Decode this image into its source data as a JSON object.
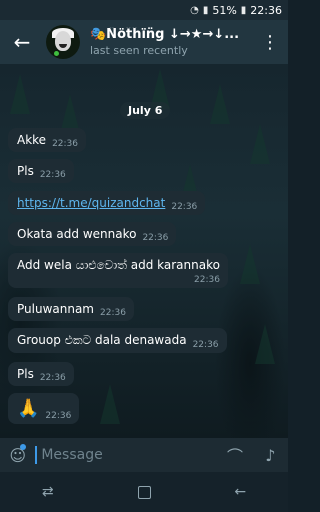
{
  "status_bar": {
    "battery": "51%",
    "time": "22:36"
  },
  "header": {
    "title": "🎭N̈öẗḧïn̈g ↓→★→↓...",
    "status": "last seen recently"
  },
  "chat": {
    "date": "July 6",
    "messages": [
      {
        "text": "Akke",
        "time": "22:36"
      },
      {
        "text": "Pls",
        "time": "22:36"
      },
      {
        "text": "https://t.me/quizandchat",
        "time": "22:36"
      },
      {
        "text": "Okata add wennako",
        "time": "22:36"
      },
      {
        "text": "Add wela යාළුවොත් add karannako",
        "time": "22:36"
      },
      {
        "text": "Puluwannam",
        "time": "22:36"
      },
      {
        "text": "Grouop එකට dala denawada",
        "time": "22:36"
      },
      {
        "text": "Pls",
        "time": "22:36"
      },
      {
        "text": "🙏",
        "time": "22:36"
      }
    ]
  },
  "input": {
    "placeholder": "Message"
  }
}
